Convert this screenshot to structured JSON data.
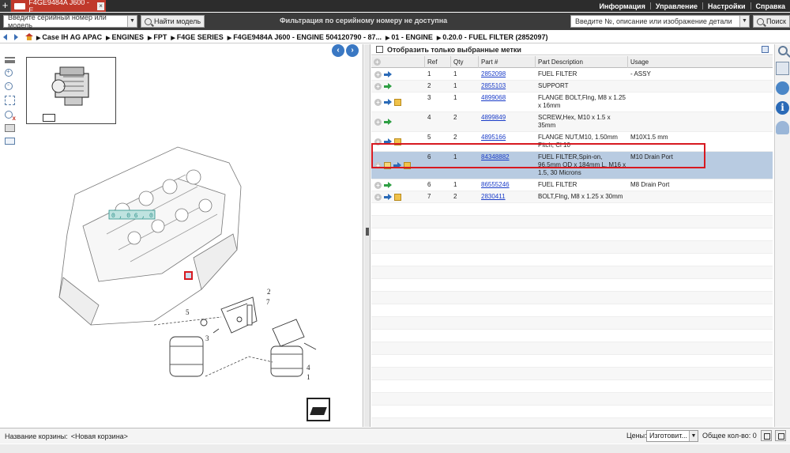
{
  "tab": {
    "title": "F4GE9484A J600 - E..."
  },
  "topmenu": [
    "Информация",
    "Управление",
    "Настройки",
    "Справка"
  ],
  "search": {
    "serial_placeholder": "Введите серийный номер или модель",
    "find_model_label": "Найти модель",
    "filter_message": "Фильтрация по серийному номеру не доступна",
    "part_placeholder": "Введите №, описание или изображение детали",
    "search_label": "Поиск"
  },
  "breadcrumb": [
    "Case IH AG APAC",
    "ENGINES",
    "FPT",
    "F4GE SERIES",
    "F4GE9484A J600 - ENGINE 504120790 - 87...",
    "01 - ENGINE",
    "0.20.0 - FUEL FILTER  (2852097)"
  ],
  "diagram": {
    "labels": [
      "2",
      "7",
      "5",
      "3",
      "4",
      "1"
    ],
    "highlight": "6",
    "placeholder_text": "0 , 0 6 , 0"
  },
  "table": {
    "filter_label": "Отобразить только выбранные метки",
    "columns": [
      "",
      "Ref",
      "Qty",
      "Part #",
      "Part Description",
      "Usage"
    ],
    "rows": [
      {
        "icons": [
          "plus",
          "blue"
        ],
        "ref": "1",
        "qty": "1",
        "part": "2852098",
        "desc": "FUEL FILTER",
        "usage": "- ASSY"
      },
      {
        "icons": [
          "plus",
          "green"
        ],
        "ref": "2",
        "qty": "1",
        "part": "2855103",
        "desc": "SUPPORT",
        "usage": ""
      },
      {
        "icons": [
          "plus",
          "blue",
          "box"
        ],
        "ref": "3",
        "qty": "1",
        "part": "4899068",
        "desc": "FLANGE BOLT,Flng, M8 x 1.25 x 16mm",
        "usage": ""
      },
      {
        "icons": [
          "plus",
          "green"
        ],
        "ref": "4",
        "qty": "2",
        "part": "4899849",
        "desc": "SCREW,Hex, M10 x 1.5 x 35mm",
        "usage": ""
      },
      {
        "icons": [
          "plus",
          "blue",
          "box"
        ],
        "ref": "5",
        "qty": "2",
        "part": "4895166",
        "desc": "FLANGE NUT,M10, 1.50mm Pitch, Cl 10",
        "usage": "M10X1.5 mm"
      },
      {
        "icons": [
          "plus",
          "note",
          "blue",
          "box"
        ],
        "ref": "6",
        "qty": "1",
        "part": "84348882",
        "desc": "FUEL FILTER,Spin-on, 96.5mm OD x 184mm L, M16 x 1.5, 30 Microns",
        "usage": "M10 Drain Port",
        "selected": true
      },
      {
        "icons": [
          "plus",
          "green"
        ],
        "ref": "6",
        "qty": "1",
        "part": "86555246",
        "desc": "FUEL FILTER",
        "usage": "M8 Drain Port"
      },
      {
        "icons": [
          "plus",
          "blue",
          "box"
        ],
        "ref": "7",
        "qty": "2",
        "part": "2830411",
        "desc": "BOLT,Flng, M8 x 1.25 x 30mm",
        "usage": ""
      }
    ]
  },
  "status": {
    "basket_label": "Название корзины:",
    "basket_name": "<Новая корзина>",
    "prices_label": "Цены:",
    "prices_value": "Изготовит...",
    "total_label": "Общее кол-во: 0"
  },
  "colors": {
    "accent": "#d71920",
    "selected_row": "#b8cbe1",
    "link": "#1a3cc8"
  }
}
